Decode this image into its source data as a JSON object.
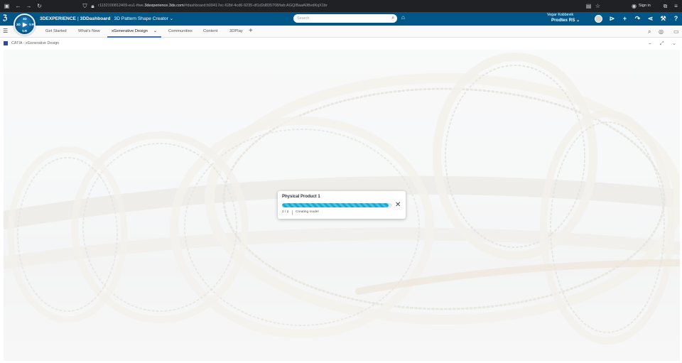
{
  "browser": {
    "url_prefix": "r1132100812409-eu1-ifwe.",
    "url_domain": "3dexperience.3ds.com",
    "url_suffix": "/#dashboard:b09417ec-62bf-4cd6-9235-df1d2d835708/tab:AGQiBaaA0BvdKqX1br",
    "signin_label": "Sign in",
    "icons": [
      "window-icon",
      "back-icon",
      "forward-icon",
      "reload-icon",
      "shield-icon",
      "lock-icon",
      "reader-icon",
      "star-icon",
      "account-icon",
      "extension-icon",
      "download-icon",
      "menu-icon"
    ]
  },
  "topbar": {
    "brand": "3DEXPERIENCE",
    "separator": "|",
    "dashboard": "3DDashboard",
    "dashboard_tab": "3D Pattern Shape Creator",
    "search_placeholder": "Search",
    "user_name": "Vegar Kobbevik",
    "company": "Prodtex RS",
    "compass_labels": {
      "top": "3D",
      "left": "3D",
      "right": "V.R",
      "bottom": "V.R"
    }
  },
  "tabs": {
    "items": [
      "Get Started",
      "What's New",
      "xGenerative Design",
      "Communities",
      "Content",
      "3DPlay"
    ],
    "active": "xGenerative Design"
  },
  "widget": {
    "title": "CATIA - xGenerative Design"
  },
  "progress_dialog": {
    "title": "Physical Product 1",
    "progress_fraction": 0.97,
    "step": "2 / 2",
    "status": "Creating model"
  },
  "colors": {
    "topbar": "#005686",
    "progress": "#17a9d6",
    "active_tab_underline": "#3b6fd1"
  }
}
